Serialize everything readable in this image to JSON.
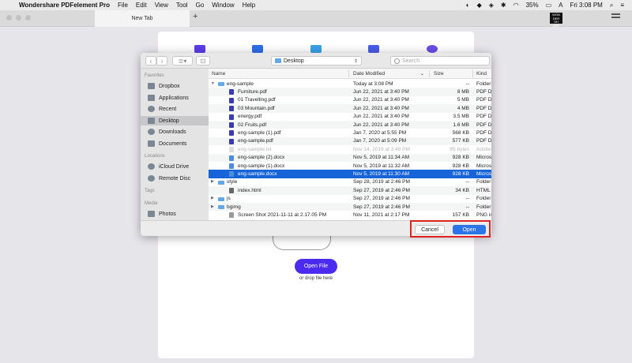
{
  "menubar": {
    "app_name": "Wondershare PDFelement Pro",
    "items": [
      "File",
      "Edit",
      "View",
      "Tool",
      "Go",
      "Window",
      "Help"
    ],
    "battery": "35%",
    "clock": "Fri 3:08 PM"
  },
  "tabs": {
    "active": "New Tab",
    "new_tab_glyph": "+"
  },
  "brand_logo": "WON DER SH ARE",
  "home": {
    "open_file": "Open File",
    "drop_hint": "or drop file here"
  },
  "dialog": {
    "location": "Desktop",
    "search_placeholder": "Search",
    "sidebar": {
      "favorites_label": "Favorites",
      "favorites": [
        "Dropbox",
        "Applications",
        "Recent",
        "Desktop",
        "Downloads",
        "Documents"
      ],
      "locations_label": "Locations",
      "locations": [
        "iCloud Drive",
        "Remote Disc"
      ],
      "tags_label": "Tags",
      "media_label": "Media",
      "media": [
        "Photos"
      ]
    },
    "columns": {
      "name": "Name",
      "date": "Date Modified",
      "size": "Size",
      "kind": "Kind"
    },
    "files": [
      {
        "name": "eng-sample",
        "date": "Today at 3:08 PM",
        "size": "--",
        "kind": "Folder",
        "type": "folder",
        "disc": "▼"
      },
      {
        "name": "Furniture.pdf",
        "date": "Jun 22, 2021 at 3:40 PM",
        "size": "8 MB",
        "kind": "PDF Do",
        "type": "pdf"
      },
      {
        "name": "01 Travelling.pdf",
        "date": "Jun 22, 2021 at 3:40 PM",
        "size": "5 MB",
        "kind": "PDF Do",
        "type": "pdf"
      },
      {
        "name": "03 Mountain.pdf",
        "date": "Jun 22, 2021 at 3:40 PM",
        "size": "4 MB",
        "kind": "PDF Do",
        "type": "pdf"
      },
      {
        "name": "energy.pdf",
        "date": "Jun 22, 2021 at 3:40 PM",
        "size": "3.5 MB",
        "kind": "PDF Do",
        "type": "pdf"
      },
      {
        "name": "02 Fruits.pdf",
        "date": "Jun 22, 2021 at 3:40 PM",
        "size": "1.6 MB",
        "kind": "PDF Do",
        "type": "pdf"
      },
      {
        "name": "eng-sample (1).pdf",
        "date": "Jan 7, 2020 at 5:55 PM",
        "size": "568 KB",
        "kind": "PDF Do",
        "type": "pdf"
      },
      {
        "name": "eng-sample.pdf",
        "date": "Jan 7, 2020 at 5:09 PM",
        "size": "577 KB",
        "kind": "PDF Do",
        "type": "pdf"
      },
      {
        "name": "eng-sample.txt",
        "date": "Nov 14, 2019 at 3:48 PM",
        "size": "85 bytes",
        "kind": "Adobe",
        "type": "gen",
        "dim": true
      },
      {
        "name": "eng-sample (2).docx",
        "date": "Nov 5, 2019 at 11:34 AM",
        "size": "928 KB",
        "kind": "Micros",
        "type": "docx"
      },
      {
        "name": "eng-sample (1).docx",
        "date": "Nov 5, 2019 at 11:32 AM",
        "size": "928 KB",
        "kind": "Micros",
        "type": "docx"
      },
      {
        "name": "eng-sample.docx",
        "date": "Nov 5, 2019 at 11:30 AM",
        "size": "928 KB",
        "kind": "Micros",
        "type": "docx",
        "selected": true
      },
      {
        "name": "style",
        "date": "Sep 28, 2019 at 2:46 PM",
        "size": "--",
        "kind": "Folder",
        "type": "folder",
        "disc": "▶"
      },
      {
        "name": "index.html",
        "date": "Sep 27, 2019 at 2:46 PM",
        "size": "34 KB",
        "kind": "HTML",
        "type": "html"
      },
      {
        "name": "js",
        "date": "Sep 27, 2019 at 2:46 PM",
        "size": "--",
        "kind": "Folder",
        "type": "folder",
        "disc": "▶"
      },
      {
        "name": "bgimg",
        "date": "Sep 27, 2019 at 2:46 PM",
        "size": "--",
        "kind": "Folder",
        "type": "folder",
        "disc": "▶"
      },
      {
        "name": "Screen Shot 2021-11-11 at 2.17.05 PM",
        "date": "Nov 11, 2021 at 2:17 PM",
        "size": "157 KB",
        "kind": "PNG im",
        "type": "img"
      }
    ],
    "cancel": "Cancel",
    "open": "Open"
  },
  "colors": {
    "accent": "#1764d8",
    "open_file_button": "#4b2bf0",
    "highlight_box": "#e02222"
  }
}
